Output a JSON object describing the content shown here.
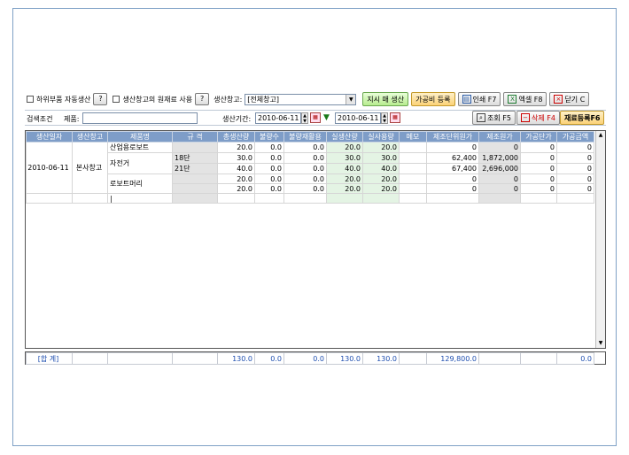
{
  "toolbar": {
    "sub_auto_label": "하위부품 자동생산",
    "help1": "?",
    "use_raw_label": "생산창고의 원재료 사용",
    "help2": "?",
    "warehouse_label": "생산창고:",
    "warehouse_value": "[전체창고]",
    "order_produce": "지시 매 생산",
    "processing_cost": "가공비 등록",
    "print": "인쇄 F7",
    "excel": "엑셀 F8",
    "close": "닫기 C"
  },
  "search": {
    "condition_label": "검색조건",
    "product_label": "제품:",
    "product_value": "",
    "period_label": "생산기간:",
    "date_from": "2010-06-11",
    "date_to": "2010-06-11",
    "query": "조회 F5",
    "delete": "삭제 F4",
    "register": "재료등록F6"
  },
  "table": {
    "headers": [
      "생산일자",
      "생산창고",
      "제품명",
      "규 격",
      "총생산량",
      "불량수",
      "불량재활용",
      "실생산량",
      "실사용량",
      "메모",
      "제조단위원가",
      "제조원가",
      "가공단가",
      "가공금액"
    ],
    "rows": [
      {
        "name": "산업용로보트",
        "spec": "",
        "total": "20.0",
        "defect": "0.0",
        "recycle": "0.0",
        "real": "20.0",
        "use": "20.0",
        "memo": "",
        "unit": "0",
        "cost": "0",
        "pu": "0",
        "pa": "0"
      },
      {
        "name": "자전거",
        "spec": "18단",
        "total": "30.0",
        "defect": "0.0",
        "recycle": "0.0",
        "real": "30.0",
        "use": "30.0",
        "memo": "",
        "unit": "62,400",
        "cost": "1,872,000",
        "pu": "0",
        "pa": "0"
      },
      {
        "name": "",
        "spec": "21단",
        "total": "40.0",
        "defect": "0.0",
        "recycle": "0.0",
        "real": "40.0",
        "use": "40.0",
        "memo": "",
        "unit": "67,400",
        "cost": "2,696,000",
        "pu": "0",
        "pa": "0"
      },
      {
        "name": "로보트머리",
        "spec": "",
        "total": "20.0",
        "defect": "0.0",
        "recycle": "0.0",
        "real": "20.0",
        "use": "20.0",
        "memo": "",
        "unit": "0",
        "cost": "0",
        "pu": "0",
        "pa": "0"
      },
      {
        "name": "",
        "spec": "",
        "total": "20.0",
        "defect": "0.0",
        "recycle": "0.0",
        "real": "20.0",
        "use": "20.0",
        "memo": "",
        "unit": "0",
        "cost": "0",
        "pu": "0",
        "pa": "0"
      }
    ],
    "group_date": "2010-06-11",
    "group_warehouse": "본사창고",
    "new_row_cursor": "|"
  },
  "summary": {
    "label": "[합 계]",
    "total": "130.0",
    "defect": "0.0",
    "recycle": "0.0",
    "real": "130.0",
    "use": "130.0",
    "unit": "129,800.0",
    "pa": "0.0"
  }
}
